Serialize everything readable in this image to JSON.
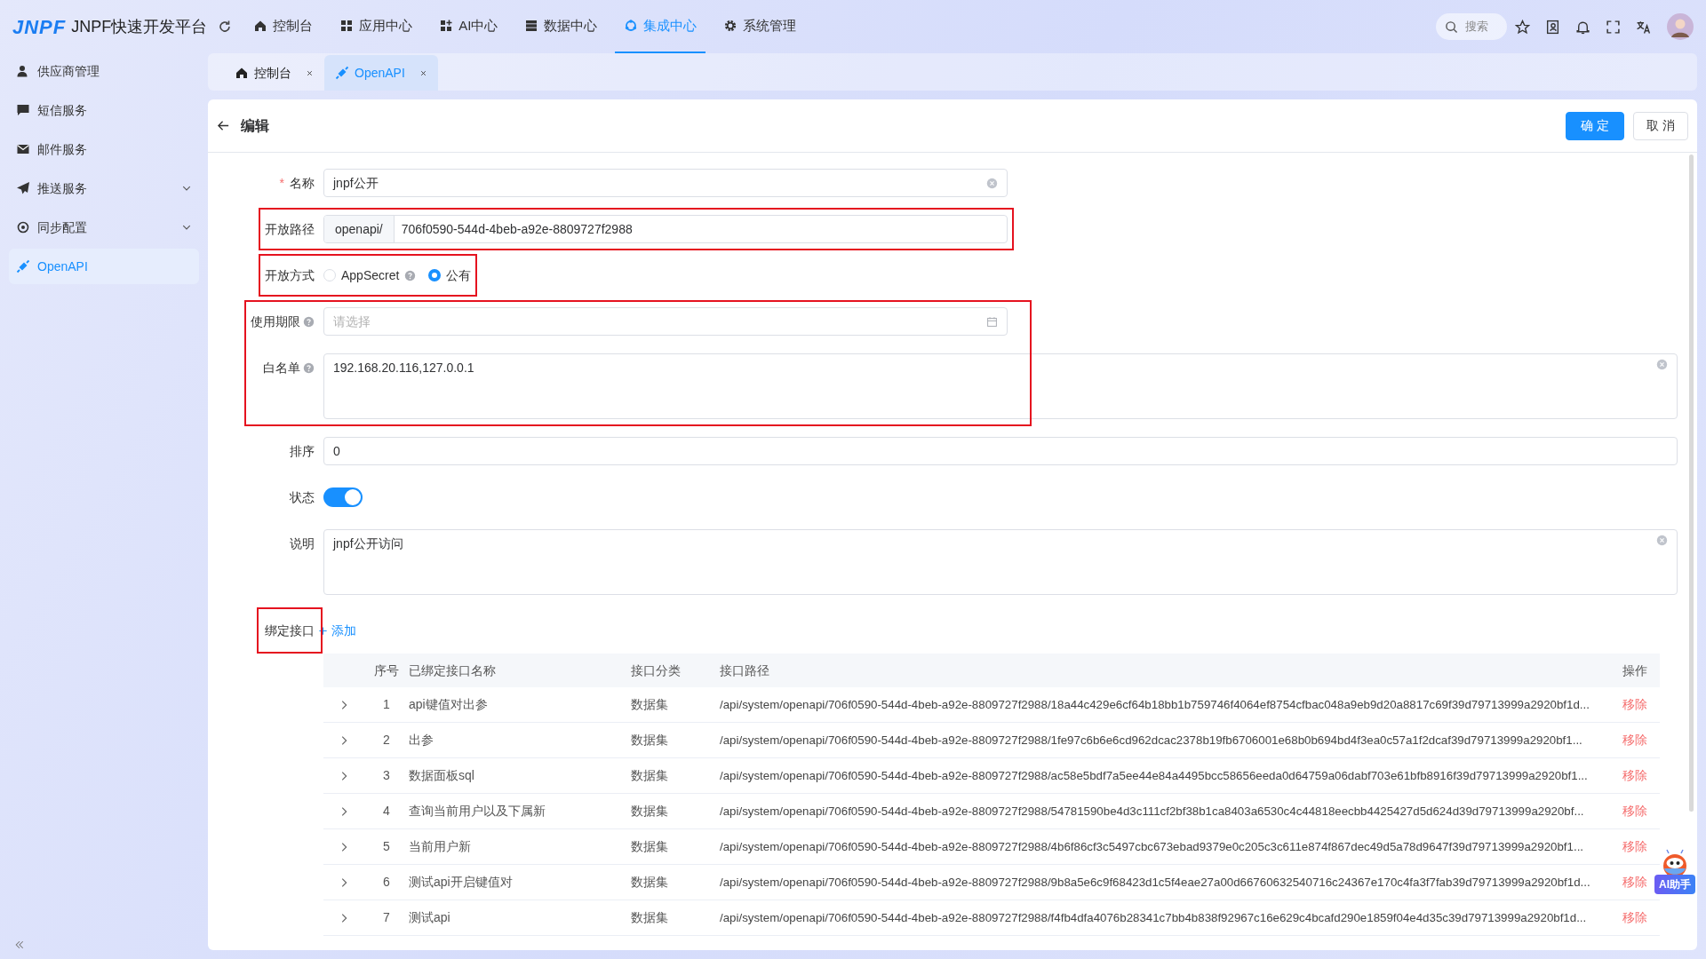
{
  "topbar": {
    "logo": "JNPF",
    "title": "JNPF快速开发平台",
    "nav": [
      {
        "label": "控制台",
        "selected": false
      },
      {
        "label": "应用中心",
        "selected": false
      },
      {
        "label": "AI中心",
        "selected": false
      },
      {
        "label": "数据中心",
        "selected": false
      },
      {
        "label": "集成中心",
        "selected": true
      },
      {
        "label": "系统管理",
        "selected": false
      }
    ],
    "search": {
      "placeholder": "搜索"
    }
  },
  "sidebar": {
    "items": [
      {
        "label": "供应商管理",
        "selected": false
      },
      {
        "label": "短信服务",
        "selected": false
      },
      {
        "label": "邮件服务",
        "selected": false
      },
      {
        "label": "推送服务",
        "selected": false,
        "expandable": true
      },
      {
        "label": "同步配置",
        "selected": false,
        "expandable": true
      },
      {
        "label": "OpenAPI",
        "selected": true
      }
    ]
  },
  "tabs": [
    {
      "label": "控制台",
      "selected": false
    },
    {
      "label": "OpenAPI",
      "selected": true
    }
  ],
  "page": {
    "title": "编辑",
    "buttons": [
      {
        "label": "确 定",
        "kind": "primary"
      },
      {
        "label": "取 消",
        "kind": "default"
      }
    ]
  },
  "form": {
    "groups": [
      {
        "highlighted": false,
        "rows": [
          {
            "kind": "input",
            "label": "名称",
            "required_mark": "*",
            "value": "jnpf公开",
            "clearable": true
          }
        ]
      },
      {
        "highlighted": true,
        "rows": [
          {
            "kind": "addon",
            "label": "开放路径",
            "prefix": "openapi/",
            "value": "706f0590-544d-4beb-a92e-8809727f2988"
          }
        ]
      },
      {
        "highlighted": true,
        "rows": [
          {
            "kind": "radio",
            "label": "开放方式",
            "options": [
              {
                "label": "AppSecret",
                "help": true,
                "selected": false
              },
              {
                "label": "公有",
                "selected": true
              }
            ]
          }
        ]
      },
      {
        "highlighted": true,
        "rows": [
          {
            "kind": "date",
            "label": "使用期限",
            "help": true,
            "placeholder": "请选择"
          },
          {
            "kind": "textarea",
            "label": "白名单",
            "help": true,
            "value": "192.168.20.116,127.0.0.1",
            "clearable": true
          }
        ]
      },
      {
        "highlighted": false,
        "rows": [
          {
            "kind": "input",
            "label": "排序",
            "value": "0"
          },
          {
            "kind": "switch",
            "label": "状态",
            "on": true
          },
          {
            "kind": "textarea",
            "label": "说明",
            "value": "jnpf公开访问",
            "clearable": true
          }
        ]
      }
    ]
  },
  "binding": {
    "label": "绑定接口",
    "highlighted": true,
    "add_label": "添加",
    "table": {
      "columns": [
        "序号",
        "已绑定接口名称",
        "接口分类",
        "接口路径",
        "操作"
      ],
      "rows": [
        {
          "expanded": false,
          "index": "1",
          "name": "api键值对出参",
          "category": "数据集",
          "path": "/api/system/openapi/706f0590-544d-4beb-a92e-8809727f2988/18a44c429e6cf64b18bb1b759746f4064ef8754cfbac048a9eb9d20a8817c69f39d79713999a2920bf1d...",
          "action": "移除"
        },
        {
          "expanded": false,
          "index": "2",
          "name": "出参",
          "category": "数据集",
          "path": "/api/system/openapi/706f0590-544d-4beb-a92e-8809727f2988/1fe97c6b6e6cd962dcac2378b19fb6706001e68b0b694bd4f3ea0c57a1f2dcaf39d79713999a2920bf1...",
          "action": "移除"
        },
        {
          "expanded": false,
          "index": "3",
          "name": "数据面板sql",
          "category": "数据集",
          "path": "/api/system/openapi/706f0590-544d-4beb-a92e-8809727f2988/ac58e5bdf7a5ee44e84a4495bcc58656eeda0d64759a06dabf703e61bfb8916f39d79713999a2920bf1...",
          "action": "移除"
        },
        {
          "expanded": false,
          "index": "4",
          "name": "查询当前用户以及下属新",
          "category": "数据集",
          "path": "/api/system/openapi/706f0590-544d-4beb-a92e-8809727f2988/54781590be4d3c111cf2bf38b1ca8403a6530c4c44818eecbb4425427d5d624d39d79713999a2920bf...",
          "action": "移除"
        },
        {
          "expanded": false,
          "index": "5",
          "name": "当前用户新",
          "category": "数据集",
          "path": "/api/system/openapi/706f0590-544d-4beb-a92e-8809727f2988/4b6f86cf3c5497cbc673ebad9379e0c205c3c611e874f867dec49d5a78d9647f39d79713999a2920bf1...",
          "action": "移除"
        },
        {
          "expanded": false,
          "index": "6",
          "name": "测试api开启键值对",
          "category": "数据集",
          "path": "/api/system/openapi/706f0590-544d-4beb-a92e-8809727f2988/9b8a5e6c9f68423d1c5f4eae27a00d66760632540716c24367e170c4fa3f7fab39d79713999a2920bf1d...",
          "action": "移除"
        },
        {
          "expanded": false,
          "index": "7",
          "name": "测试api",
          "category": "数据集",
          "path": "/api/system/openapi/706f0590-544d-4beb-a92e-8809727f2988/f4fb4dfa4076b28341c7bb4b838f92967c16e629c4bcafd290e1859f04e4d35c39d79713999a2920bf1d...",
          "action": "移除"
        }
      ]
    }
  },
  "ai_assistant": {
    "label": "AI助手"
  }
}
